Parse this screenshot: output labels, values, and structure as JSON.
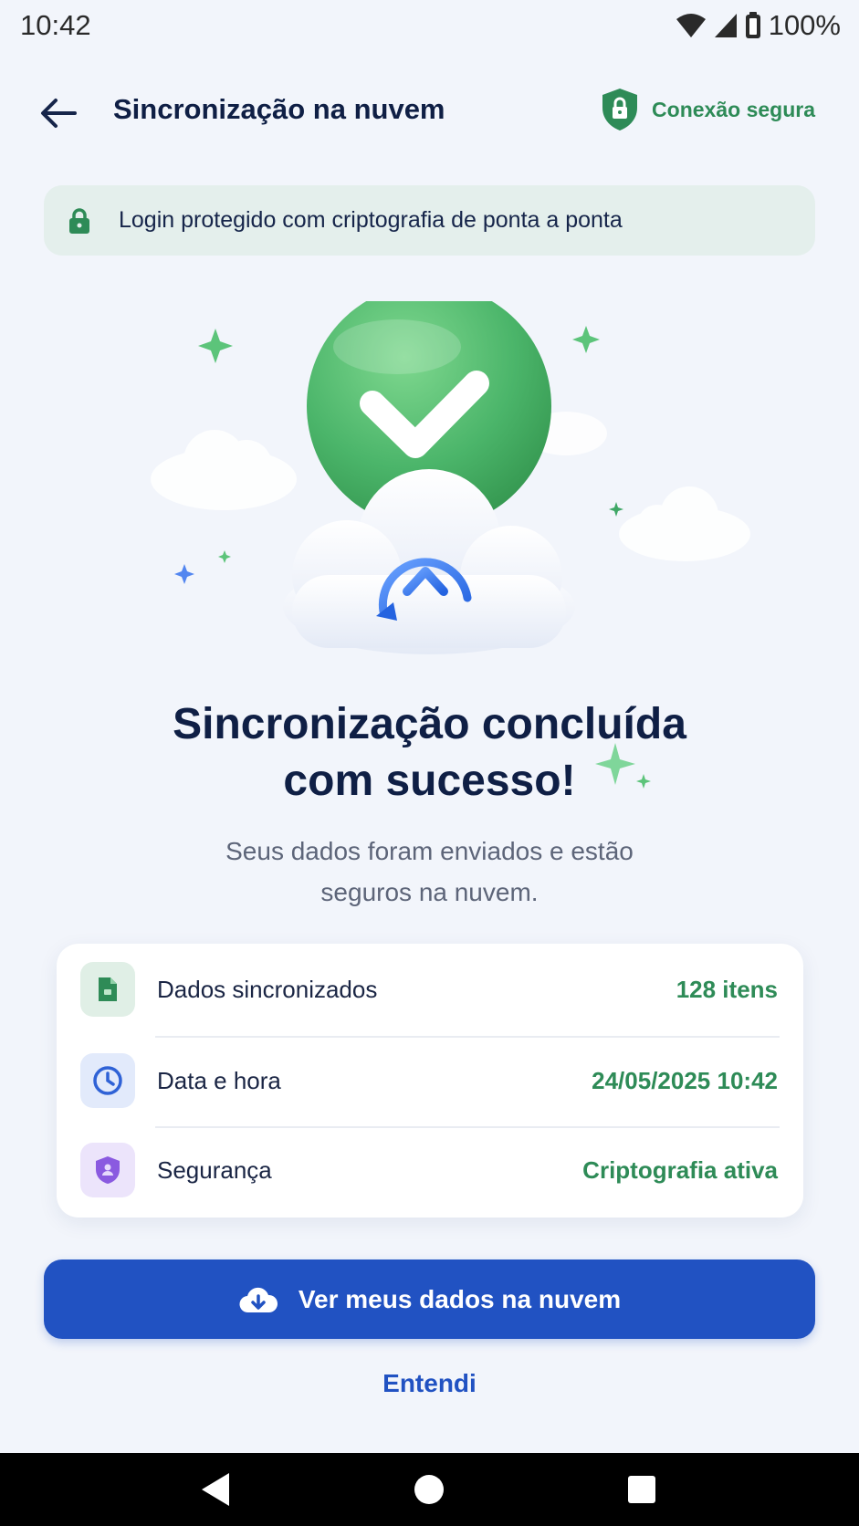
{
  "status_bar": {
    "time": "10:42",
    "battery": "100%",
    "icons": [
      "wifi-icon",
      "signal-icon",
      "battery-icon"
    ]
  },
  "header": {
    "title": "Sincronização na nuvem",
    "secure_label": "Conexão segura",
    "back_icon": "arrow-left-icon",
    "secure_icon": "shield-lock-icon"
  },
  "banner": {
    "text": "Login protegido com criptografia de ponta a ponta",
    "icon": "lock-icon"
  },
  "success": {
    "title_line1": "Sincronização concluída",
    "title_line2": "com sucesso!",
    "subtitle_line1": "Seus dados foram enviados e estão",
    "subtitle_line2": "seguros na nuvem."
  },
  "details": {
    "rows": [
      {
        "label": "Dados sincronizados",
        "value": "128 itens",
        "icon": "document-icon"
      },
      {
        "label": "Data e hora",
        "value": "24/05/2025 10:42",
        "icon": "clock-icon"
      },
      {
        "label": "Segurança",
        "value": "Criptografia ativa",
        "icon": "shield-user-icon"
      }
    ]
  },
  "actions": {
    "primary_label": "Ver meus dados na nuvem",
    "secondary_label": "Entendi"
  },
  "colors": {
    "accent": "#2152c2",
    "success": "#2e8b57",
    "title": "#0f1f45",
    "background": "#f2f5fb"
  }
}
